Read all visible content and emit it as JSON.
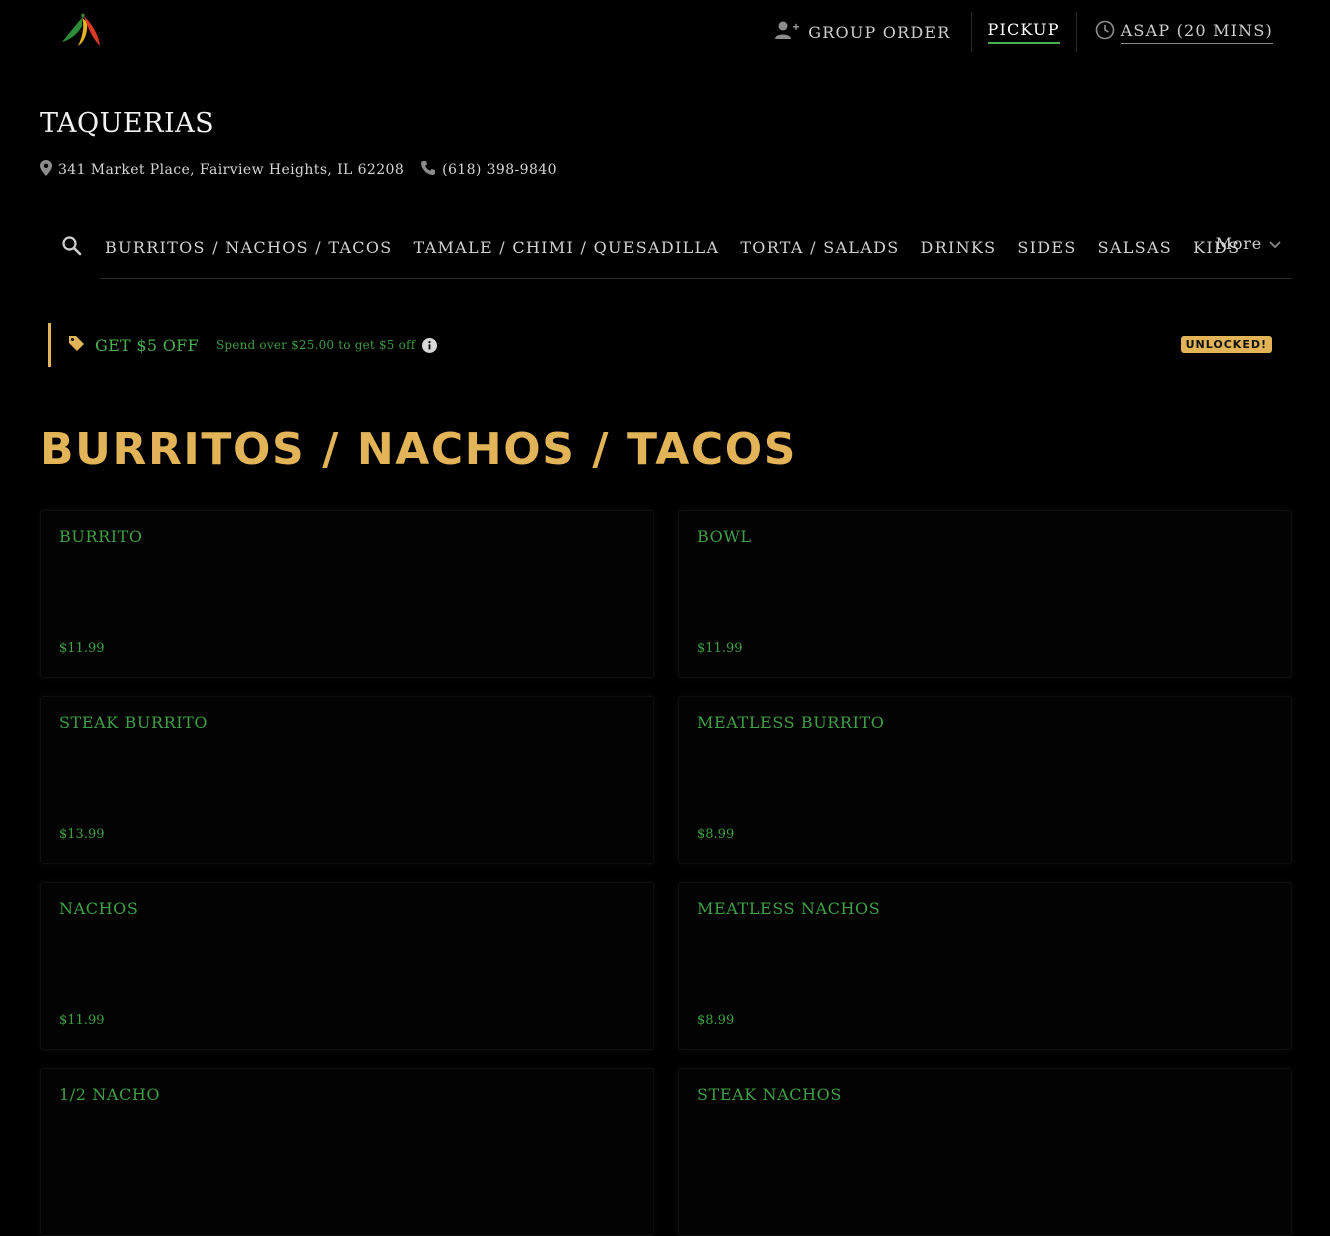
{
  "header": {
    "logo_icon": "chili-pepper-logo",
    "group_order_label": "GROUP ORDER",
    "group_order_icon": "add-person-icon",
    "pickup_label": "PICKUP",
    "time_label": "ASAP (20 MINS)",
    "time_icon": "clock-icon"
  },
  "restaurant": {
    "name": "TAQUERIAS",
    "address": "341 Market Place, Fairview Heights, IL 62208",
    "phone": "(618) 398-9840"
  },
  "nav": {
    "items": [
      "BURRITOS / NACHOS / TACOS",
      "TAMALE / CHIMI / QUESADILLA",
      "TORTA / SALADS",
      "DRINKS",
      "SIDES",
      "SALSAS",
      "KIDS"
    ],
    "more_label": "More"
  },
  "promo": {
    "title": "GET $5 OFF",
    "description": "Spend over $25.00 to get $5 off",
    "badge": "UNLOCKED!"
  },
  "section": {
    "title": "BURRITOS / NACHOS / TACOS"
  },
  "items": [
    {
      "name": "BURRITO",
      "price": "$11.99"
    },
    {
      "name": "BOWL",
      "price": "$11.99"
    },
    {
      "name": "STEAK BURRITO",
      "price": "$13.99"
    },
    {
      "name": "MEATLESS BURRITO",
      "price": "$8.99"
    },
    {
      "name": "NACHOS",
      "price": "$11.99"
    },
    {
      "name": "MEATLESS NACHOS",
      "price": "$8.99"
    },
    {
      "name": "1/2 NACHO",
      "price": ""
    },
    {
      "name": "STEAK NACHOS",
      "price": ""
    }
  ],
  "colors": {
    "background": "#000000",
    "accent_gold": "#e2b457",
    "accent_green": "#4caf50"
  }
}
